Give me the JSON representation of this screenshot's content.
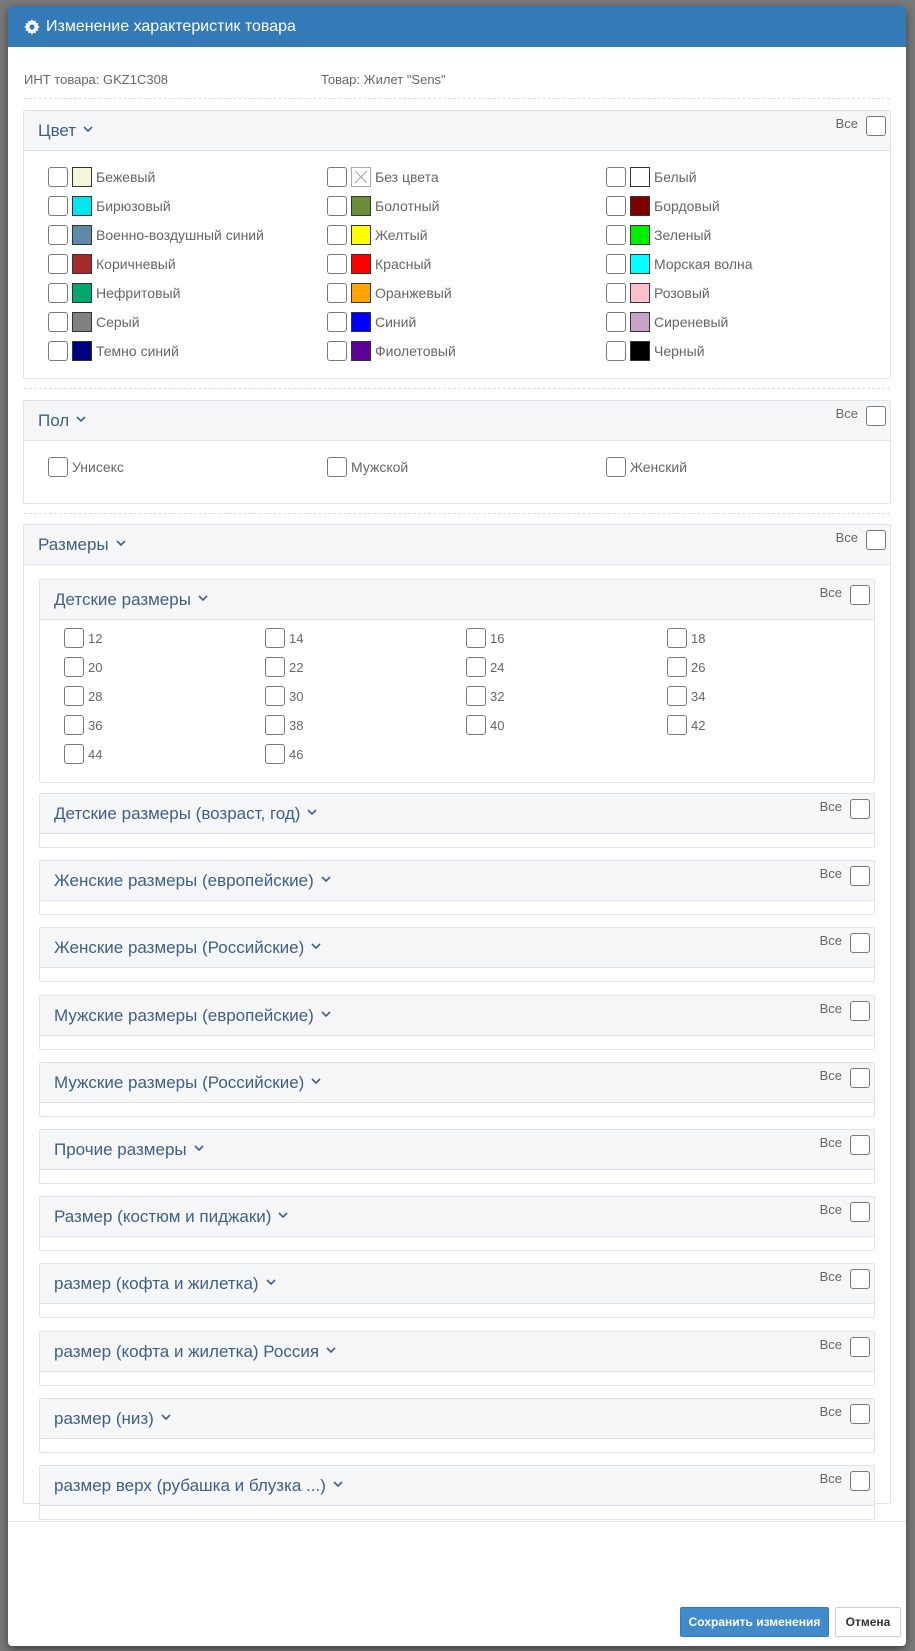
{
  "header": {
    "title": "Изменение характеристик товара",
    "icon": "gear-icon"
  },
  "info": {
    "int_label": "ИНТ товара: GKZ1C308",
    "product_label": "Товар: Жилет \"Sens\""
  },
  "all_label": "Все",
  "color_section": {
    "title": "Цвет",
    "colors": [
      {
        "name": "Бежевый",
        "hex": "#f5f5dc"
      },
      {
        "name": "Без цвета",
        "hex": "none"
      },
      {
        "name": "Белый",
        "hex": "#ffffff"
      },
      {
        "name": "Бирюзовый",
        "hex": "#00e5ee"
      },
      {
        "name": "Болотный",
        "hex": "#6b8e3a"
      },
      {
        "name": "Бордовый",
        "hex": "#800000"
      },
      {
        "name": "Военно-воздушный синий",
        "hex": "#5d8aa8"
      },
      {
        "name": "Желтый",
        "hex": "#ffff00"
      },
      {
        "name": "Зеленый",
        "hex": "#00ee00"
      },
      {
        "name": "Коричневый",
        "hex": "#a52a2a"
      },
      {
        "name": "Красный",
        "hex": "#ff0000"
      },
      {
        "name": "Морская волна",
        "hex": "#00ffff"
      },
      {
        "name": "Нефритовый",
        "hex": "#00a86b"
      },
      {
        "name": "Оранжевый",
        "hex": "#ffa500"
      },
      {
        "name": "Розовый",
        "hex": "#ffc0cb"
      },
      {
        "name": "Серый",
        "hex": "#808080"
      },
      {
        "name": "Синий",
        "hex": "#0000ff"
      },
      {
        "name": "Сиреневый",
        "hex": "#c8a2c8"
      },
      {
        "name": "Темно синий",
        "hex": "#000080"
      },
      {
        "name": "Фиолетовый",
        "hex": "#5c0099"
      },
      {
        "name": "Черный",
        "hex": "#000000"
      }
    ]
  },
  "gender_section": {
    "title": "Пол",
    "options": [
      "Унисекс",
      "Мужской",
      "Женский"
    ]
  },
  "sizes_section": {
    "title": "Размеры",
    "kids": {
      "title": "Детские размеры",
      "sizes": [
        "12",
        "14",
        "16",
        "18",
        "20",
        "22",
        "24",
        "26",
        "28",
        "30",
        "32",
        "34",
        "36",
        "38",
        "40",
        "42",
        "44",
        "46"
      ]
    },
    "subgroups": [
      "Детские размеры (возраст, год)",
      "Женские размеры (европейские)",
      "Женские размеры (Российские)",
      "Мужские размеры (европейские)",
      "Мужские размеры (Российские)",
      "Прочие размеры",
      "Размер (костюм и пиджаки)",
      "размер (кофта и жилетка)",
      "размер (кофта и жилетка) Россия",
      "размер (низ)",
      "размер верх (рубашка и блузка ...)"
    ]
  },
  "footer": {
    "save_label": "Сохранить изменения",
    "cancel_label": "Отмена"
  }
}
